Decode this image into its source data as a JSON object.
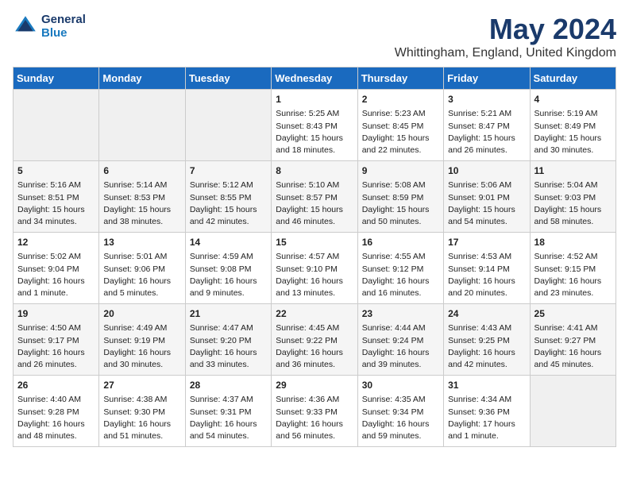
{
  "header": {
    "logo_line1": "General",
    "logo_line2": "Blue",
    "month": "May 2024",
    "location": "Whittingham, England, United Kingdom"
  },
  "weekdays": [
    "Sunday",
    "Monday",
    "Tuesday",
    "Wednesday",
    "Thursday",
    "Friday",
    "Saturday"
  ],
  "weeks": [
    [
      {
        "day": "",
        "lines": []
      },
      {
        "day": "",
        "lines": []
      },
      {
        "day": "",
        "lines": []
      },
      {
        "day": "1",
        "lines": [
          "Sunrise: 5:25 AM",
          "Sunset: 8:43 PM",
          "Daylight: 15 hours",
          "and 18 minutes."
        ]
      },
      {
        "day": "2",
        "lines": [
          "Sunrise: 5:23 AM",
          "Sunset: 8:45 PM",
          "Daylight: 15 hours",
          "and 22 minutes."
        ]
      },
      {
        "day": "3",
        "lines": [
          "Sunrise: 5:21 AM",
          "Sunset: 8:47 PM",
          "Daylight: 15 hours",
          "and 26 minutes."
        ]
      },
      {
        "day": "4",
        "lines": [
          "Sunrise: 5:19 AM",
          "Sunset: 8:49 PM",
          "Daylight: 15 hours",
          "and 30 minutes."
        ]
      }
    ],
    [
      {
        "day": "5",
        "lines": [
          "Sunrise: 5:16 AM",
          "Sunset: 8:51 PM",
          "Daylight: 15 hours",
          "and 34 minutes."
        ]
      },
      {
        "day": "6",
        "lines": [
          "Sunrise: 5:14 AM",
          "Sunset: 8:53 PM",
          "Daylight: 15 hours",
          "and 38 minutes."
        ]
      },
      {
        "day": "7",
        "lines": [
          "Sunrise: 5:12 AM",
          "Sunset: 8:55 PM",
          "Daylight: 15 hours",
          "and 42 minutes."
        ]
      },
      {
        "day": "8",
        "lines": [
          "Sunrise: 5:10 AM",
          "Sunset: 8:57 PM",
          "Daylight: 15 hours",
          "and 46 minutes."
        ]
      },
      {
        "day": "9",
        "lines": [
          "Sunrise: 5:08 AM",
          "Sunset: 8:59 PM",
          "Daylight: 15 hours",
          "and 50 minutes."
        ]
      },
      {
        "day": "10",
        "lines": [
          "Sunrise: 5:06 AM",
          "Sunset: 9:01 PM",
          "Daylight: 15 hours",
          "and 54 minutes."
        ]
      },
      {
        "day": "11",
        "lines": [
          "Sunrise: 5:04 AM",
          "Sunset: 9:03 PM",
          "Daylight: 15 hours",
          "and 58 minutes."
        ]
      }
    ],
    [
      {
        "day": "12",
        "lines": [
          "Sunrise: 5:02 AM",
          "Sunset: 9:04 PM",
          "Daylight: 16 hours",
          "and 1 minute."
        ]
      },
      {
        "day": "13",
        "lines": [
          "Sunrise: 5:01 AM",
          "Sunset: 9:06 PM",
          "Daylight: 16 hours",
          "and 5 minutes."
        ]
      },
      {
        "day": "14",
        "lines": [
          "Sunrise: 4:59 AM",
          "Sunset: 9:08 PM",
          "Daylight: 16 hours",
          "and 9 minutes."
        ]
      },
      {
        "day": "15",
        "lines": [
          "Sunrise: 4:57 AM",
          "Sunset: 9:10 PM",
          "Daylight: 16 hours",
          "and 13 minutes."
        ]
      },
      {
        "day": "16",
        "lines": [
          "Sunrise: 4:55 AM",
          "Sunset: 9:12 PM",
          "Daylight: 16 hours",
          "and 16 minutes."
        ]
      },
      {
        "day": "17",
        "lines": [
          "Sunrise: 4:53 AM",
          "Sunset: 9:14 PM",
          "Daylight: 16 hours",
          "and 20 minutes."
        ]
      },
      {
        "day": "18",
        "lines": [
          "Sunrise: 4:52 AM",
          "Sunset: 9:15 PM",
          "Daylight: 16 hours",
          "and 23 minutes."
        ]
      }
    ],
    [
      {
        "day": "19",
        "lines": [
          "Sunrise: 4:50 AM",
          "Sunset: 9:17 PM",
          "Daylight: 16 hours",
          "and 26 minutes."
        ]
      },
      {
        "day": "20",
        "lines": [
          "Sunrise: 4:49 AM",
          "Sunset: 9:19 PM",
          "Daylight: 16 hours",
          "and 30 minutes."
        ]
      },
      {
        "day": "21",
        "lines": [
          "Sunrise: 4:47 AM",
          "Sunset: 9:20 PM",
          "Daylight: 16 hours",
          "and 33 minutes."
        ]
      },
      {
        "day": "22",
        "lines": [
          "Sunrise: 4:45 AM",
          "Sunset: 9:22 PM",
          "Daylight: 16 hours",
          "and 36 minutes."
        ]
      },
      {
        "day": "23",
        "lines": [
          "Sunrise: 4:44 AM",
          "Sunset: 9:24 PM",
          "Daylight: 16 hours",
          "and 39 minutes."
        ]
      },
      {
        "day": "24",
        "lines": [
          "Sunrise: 4:43 AM",
          "Sunset: 9:25 PM",
          "Daylight: 16 hours",
          "and 42 minutes."
        ]
      },
      {
        "day": "25",
        "lines": [
          "Sunrise: 4:41 AM",
          "Sunset: 9:27 PM",
          "Daylight: 16 hours",
          "and 45 minutes."
        ]
      }
    ],
    [
      {
        "day": "26",
        "lines": [
          "Sunrise: 4:40 AM",
          "Sunset: 9:28 PM",
          "Daylight: 16 hours",
          "and 48 minutes."
        ]
      },
      {
        "day": "27",
        "lines": [
          "Sunrise: 4:38 AM",
          "Sunset: 9:30 PM",
          "Daylight: 16 hours",
          "and 51 minutes."
        ]
      },
      {
        "day": "28",
        "lines": [
          "Sunrise: 4:37 AM",
          "Sunset: 9:31 PM",
          "Daylight: 16 hours",
          "and 54 minutes."
        ]
      },
      {
        "day": "29",
        "lines": [
          "Sunrise: 4:36 AM",
          "Sunset: 9:33 PM",
          "Daylight: 16 hours",
          "and 56 minutes."
        ]
      },
      {
        "day": "30",
        "lines": [
          "Sunrise: 4:35 AM",
          "Sunset: 9:34 PM",
          "Daylight: 16 hours",
          "and 59 minutes."
        ]
      },
      {
        "day": "31",
        "lines": [
          "Sunrise: 4:34 AM",
          "Sunset: 9:36 PM",
          "Daylight: 17 hours",
          "and 1 minute."
        ]
      },
      {
        "day": "",
        "lines": []
      }
    ]
  ]
}
